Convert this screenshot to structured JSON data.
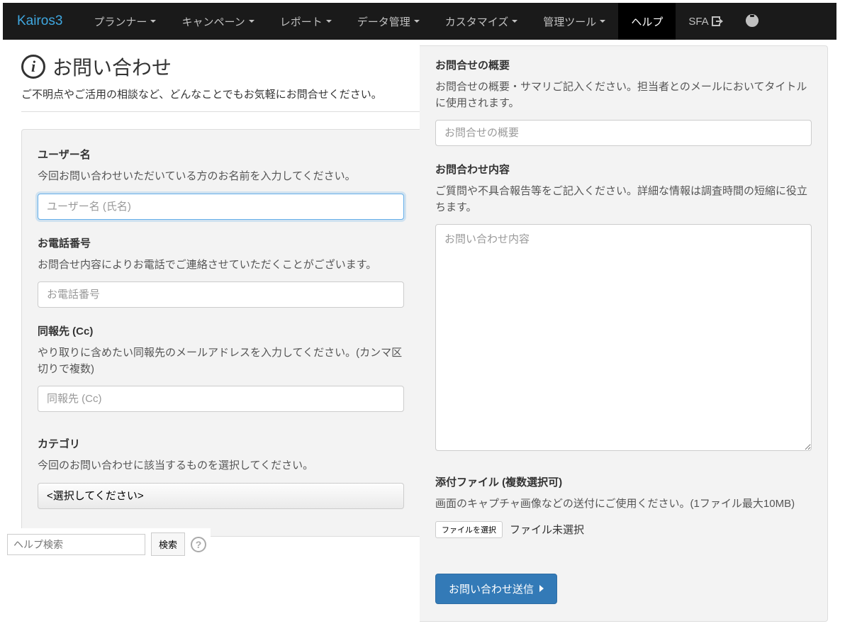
{
  "navbar": {
    "brand": "Kairos3",
    "items": [
      "プランナー",
      "キャンペーン",
      "レポート",
      "データ管理",
      "カスタマイズ",
      "管理ツール"
    ],
    "help": "ヘルプ",
    "sfa": "SFA"
  },
  "page": {
    "title": "お問い合わせ",
    "description": "ご不明点やご活用の相談など、どんなことでもお気軽にお問合せください。"
  },
  "form": {
    "username": {
      "label": "ユーザー名",
      "help": "今回お問い合わせいただいている方のお名前を入力してください。",
      "placeholder": "ユーザー名 (氏名)"
    },
    "phone": {
      "label": "お電話番号",
      "help": "お問合せ内容によりお電話でご連絡させていただくことがございます。",
      "placeholder": "お電話番号"
    },
    "cc": {
      "label": "同報先 (Cc)",
      "help": "やり取りに含めたい同報先のメールアドレスを入力してください。(カンマ区切りで複数)",
      "placeholder": "同報先 (Cc)"
    },
    "category": {
      "label": "カテゴリ",
      "help": "今回のお問い合わせに該当するものを選択してください。",
      "placeholder": "<選択してください>"
    },
    "summary": {
      "label": "お問合せの概要",
      "help": "お問合せの概要・サマリご記入ください。担当者とのメールにおいてタイトルに使用されます。",
      "placeholder": "お問合せの概要"
    },
    "content": {
      "label": "お問合わせ内容",
      "help": "ご質問や不具合報告等をご記入ください。詳細な情報は調査時間の短縮に役立ちます。",
      "placeholder": "お問い合わせ内容"
    },
    "attachment": {
      "label": "添付ファイル (複数選択可)",
      "help": "画面のキャプチャ画像などの送付にご使用ください。(1ファイル最大10MB)",
      "button": "ファイルを選択",
      "status": "ファイル未選択"
    },
    "submit": "お問い合わせ送信"
  },
  "helpSearch": {
    "placeholder": "ヘルプ検索",
    "button": "検索"
  }
}
